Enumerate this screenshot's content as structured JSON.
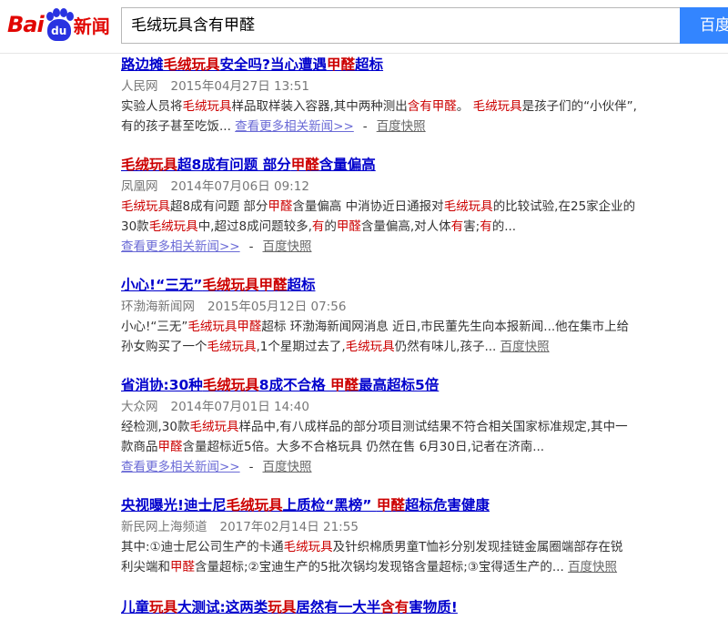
{
  "header": {
    "logo_text_bai": "Bai",
    "logo_text_du": "du",
    "logo_text_news": "新闻",
    "query": "毛绒玩具含有甲醛",
    "search_button": "百度"
  },
  "results": [
    {
      "title": [
        "路边摊",
        "毛绒玩具",
        "安全吗?当心遭遇",
        "甲醛",
        "超标"
      ],
      "title_em": [
        false,
        true,
        false,
        true,
        false
      ],
      "source": "人民网",
      "date": "2015年04月27日 13:51",
      "abstract": [
        [
          [
            "实验人员将",
            false
          ],
          [
            "毛绒玩具",
            true
          ],
          [
            "样品取样装入容器,其中两种测出",
            false
          ],
          [
            "含有甲醛",
            true
          ],
          [
            "。 ",
            false
          ],
          [
            "毛绒玩具",
            true
          ],
          [
            "是孩子们的“小伙伴”,",
            false
          ]
        ],
        [
          [
            "有的孩子甚至吃饭... ",
            false
          ]
        ]
      ],
      "more": "查看更多相关新闻>>",
      "dash": "-",
      "cache": "百度快照"
    },
    {
      "title": [
        "毛绒玩具",
        "超8成有问题 部分",
        "甲醛",
        "含量偏高"
      ],
      "title_em": [
        true,
        false,
        true,
        false
      ],
      "source": "凤凰网",
      "date": "2014年07月06日 09:12",
      "abstract": [
        [
          [
            "毛绒玩具",
            true
          ],
          [
            "超8成有问题 部分",
            false
          ],
          [
            "甲醛",
            true
          ],
          [
            "含量偏高 中消协近日通报对",
            false
          ],
          [
            "毛绒玩具",
            true
          ],
          [
            "的比较试验,在25家企业的",
            false
          ]
        ],
        [
          [
            "30款",
            false
          ],
          [
            "毛绒玩具",
            true
          ],
          [
            "中,超过8成问题较多,",
            false
          ],
          [
            "有",
            true
          ],
          [
            "的",
            false
          ],
          [
            "甲醛",
            true
          ],
          [
            "含量偏高,对人体",
            false
          ],
          [
            "有",
            true
          ],
          [
            "害;",
            false
          ],
          [
            "有",
            true
          ],
          [
            "的...",
            false
          ]
        ]
      ],
      "more": "查看更多相关新闻>>",
      "dash": "-",
      "cache": "百度快照"
    },
    {
      "title": [
        "小心!“三无”",
        "毛绒玩具甲醛",
        "超标"
      ],
      "title_em": [
        false,
        true,
        false
      ],
      "source": "环渤海新闻网",
      "date": "2015年05月12日 07:56",
      "abstract": [
        [
          [
            "小心!“三无”",
            false
          ],
          [
            "毛绒玩具甲醛",
            true
          ],
          [
            "超标 环渤海新闻网消息 近日,市民董先生向本报新闻...他在集市上给",
            false
          ]
        ],
        [
          [
            "孙女购买了一个",
            false
          ],
          [
            "毛绒玩具",
            true
          ],
          [
            ",1个星期过去了,",
            false
          ],
          [
            "毛绒玩具",
            true
          ],
          [
            "仍然有味儿,孩子... ",
            false
          ]
        ]
      ],
      "more": "",
      "dash": "",
      "cache": "百度快照"
    },
    {
      "title": [
        "省消协:30种",
        "毛绒玩具",
        "8成不合格 ",
        "甲醛",
        "最高超标5倍"
      ],
      "title_em": [
        false,
        true,
        false,
        true,
        false
      ],
      "source": "大众网",
      "date": "2014年07月01日 14:40",
      "abstract": [
        [
          [
            "经检测,30款",
            false
          ],
          [
            "毛绒玩具",
            true
          ],
          [
            "样品中,有八成样品的部分项目测试结果不符合相关国家标准规定,其中一",
            false
          ]
        ],
        [
          [
            "款商品",
            false
          ],
          [
            "甲醛",
            true
          ],
          [
            "含量超标近5倍。大多不合格玩具 仍然在售 6月30日,记者在济南...",
            false
          ]
        ]
      ],
      "more": "查看更多相关新闻>>",
      "dash": "-",
      "cache": "百度快照"
    },
    {
      "title": [
        "央视曝光!迪士尼",
        "毛绒玩具",
        "上质检“黑榜” ",
        "甲醛",
        "超标危害健康"
      ],
      "title_em": [
        false,
        true,
        false,
        true,
        false
      ],
      "source": "新民网上海频道",
      "date": "2017年02月14日 21:55",
      "abstract": [
        [
          [
            "其中:①迪士尼公司生产的卡通",
            false
          ],
          [
            "毛绒玩具",
            true
          ],
          [
            "及针织棉质男童T恤衫分别发现挂链金属圈端部存在锐",
            false
          ]
        ],
        [
          [
            "利尖端和",
            false
          ],
          [
            "甲醛",
            true
          ],
          [
            "含量超标;②宝迪生产的5批次锅均发现铬含量超标;③宝得适生产的... ",
            false
          ]
        ]
      ],
      "more": "",
      "dash": "",
      "cache": "百度快照"
    },
    {
      "title": [
        "儿童",
        "玩具",
        "大测试:这两类",
        "玩具",
        "居然有一大半",
        "含有",
        "害物质!"
      ],
      "title_em": [
        false,
        true,
        false,
        true,
        false,
        true,
        false
      ],
      "source": "",
      "date": "",
      "abstract": [],
      "more": "",
      "dash": "",
      "cache": ""
    }
  ]
}
